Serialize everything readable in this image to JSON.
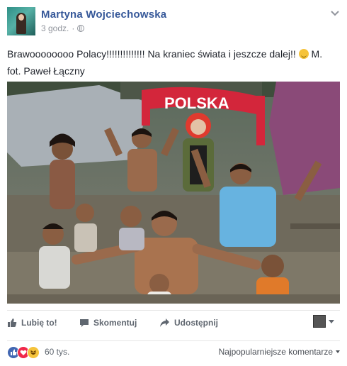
{
  "post": {
    "author": "Martyna Wojciechowska",
    "timestamp": "3 godz.",
    "privacy_icon": "globe-icon",
    "text_line1": "Brawoooooooo Polacy!!!!!!!!!!!!!! Na kraniec świata i jeszcze dalej!!",
    "text_line1_end": "M.",
    "text_line2": "fot. Paweł Łączny",
    "photo_banner_text": "POLSKA"
  },
  "actions": {
    "like_label": "Lubię to!",
    "comment_label": "Skomentuj",
    "share_label": "Udostępnij"
  },
  "reactions": {
    "count": "60 tys.",
    "sort_label": "Najpopularniejsze komentarze",
    "colors": {
      "like": "#4267b2",
      "love": "#f0284a",
      "haha": "#f5c33b"
    }
  },
  "theme": {
    "link": "#365899",
    "muted": "#90949c",
    "text": "#1d2129"
  }
}
